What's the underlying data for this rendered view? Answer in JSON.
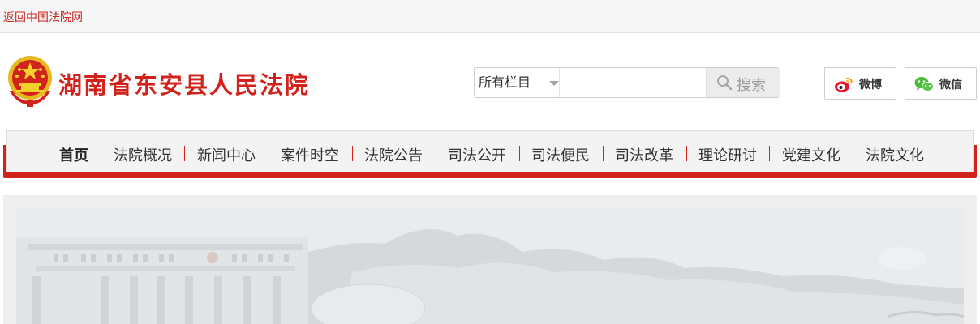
{
  "topbar": {
    "back_link": "返回中国法院网"
  },
  "header": {
    "emblem_icon": "national-emblem-icon",
    "site_title": "湖南省东安县人民法院",
    "brand_color": "#d1231c"
  },
  "search": {
    "select_value": "所有栏目",
    "input_value": "",
    "button_label": "搜索",
    "button_icon": "search-icon"
  },
  "social": [
    {
      "label": "微博",
      "icon": "weibo-icon"
    },
    {
      "label": "微信",
      "icon": "wechat-icon"
    }
  ],
  "nav": {
    "items": [
      {
        "label": "首页",
        "active": true
      },
      {
        "label": "法院概况"
      },
      {
        "label": "新闻中心"
      },
      {
        "label": "案件时空"
      },
      {
        "label": "法院公告"
      },
      {
        "label": "司法公开"
      },
      {
        "label": "司法便民"
      },
      {
        "label": "司法改革"
      },
      {
        "label": "理论研讨"
      },
      {
        "label": "党建文化"
      },
      {
        "label": "法院文化"
      }
    ]
  }
}
